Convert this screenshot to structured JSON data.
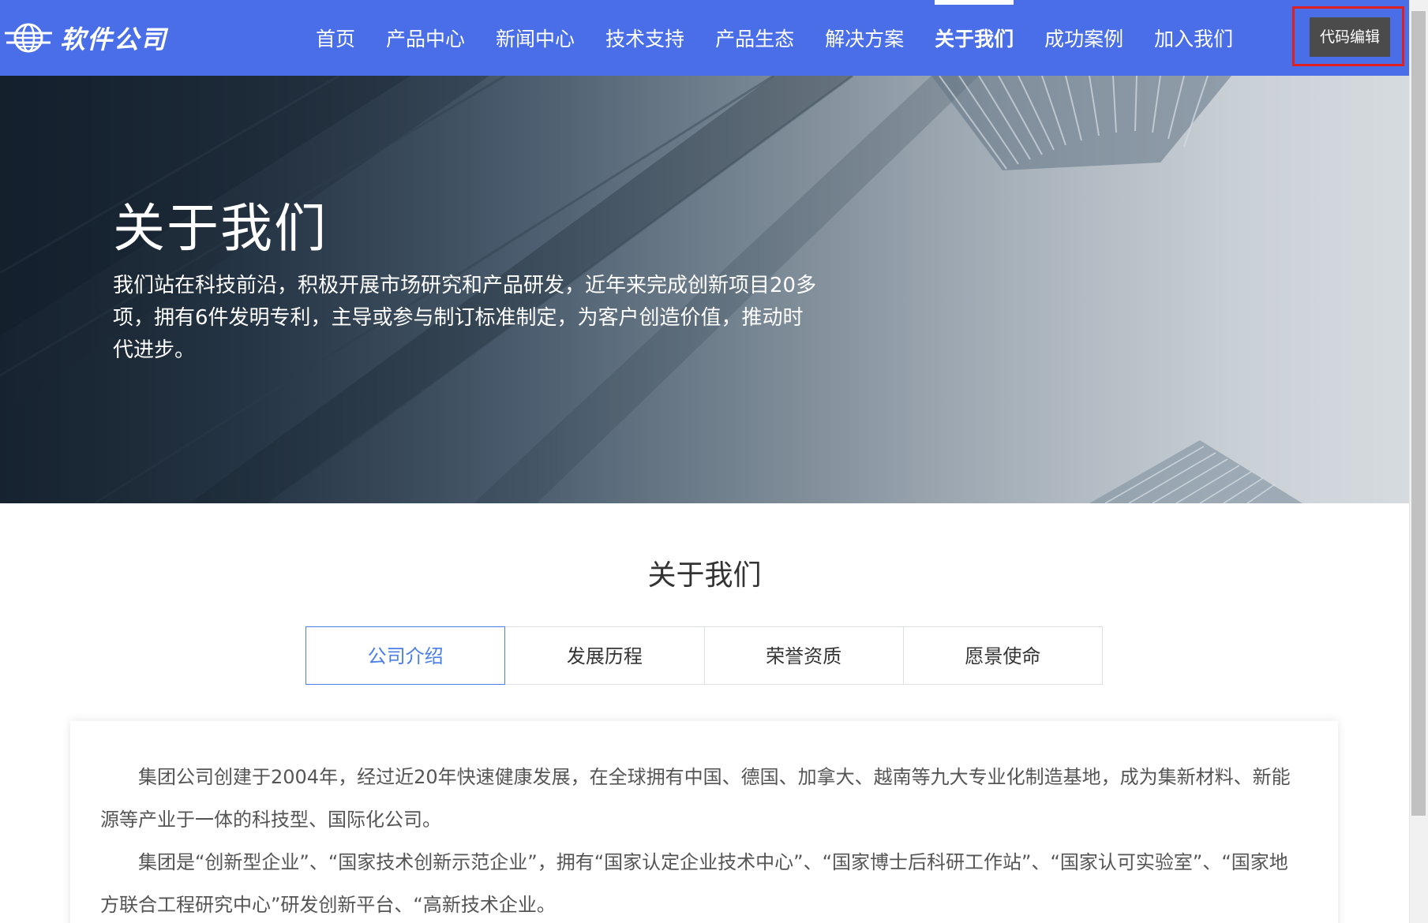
{
  "header": {
    "logo_text": "软件公司",
    "nav": [
      {
        "label": "首页"
      },
      {
        "label": "产品中心"
      },
      {
        "label": "新闻中心"
      },
      {
        "label": "技术支持"
      },
      {
        "label": "产品生态"
      },
      {
        "label": "解决方案"
      },
      {
        "label": "关于我们",
        "active": true
      },
      {
        "label": "成功案例"
      },
      {
        "label": "加入我们"
      }
    ],
    "code_edit_label": "代码编辑",
    "brand_color": "#4a6ee8",
    "highlight_color": "#e02020"
  },
  "hero": {
    "title": "关于我们",
    "description": "我们站在科技前沿，积极开展市场研究和产品研发，近年来完成创新项目20多项，拥有6件发明专利，主导或参与制订标准制定，为客户创造价值，推动时代进步。"
  },
  "about": {
    "title": "关于我们",
    "tabs": [
      {
        "label": "公司介绍",
        "active": true
      },
      {
        "label": "发展历程"
      },
      {
        "label": "荣誉资质"
      },
      {
        "label": "愿景使命"
      }
    ],
    "paragraphs": [
      "集团公司创建于2004年，经过近20年快速健康发展，在全球拥有中国、德国、加拿大、越南等九大专业化制造基地，成为集新材料、新能源等产业于一体的科技型、国际化公司。",
      "集团是“创新型企业”、“国家技术创新示范企业”，拥有“国家认定企业技术中心”、“国家博士后科研工作站”、“国家认可实验室”、“国家地方联合工程研究中心”研发创新平台、“高新技术企业。"
    ],
    "active_tab_color": "#4a7ee8"
  }
}
